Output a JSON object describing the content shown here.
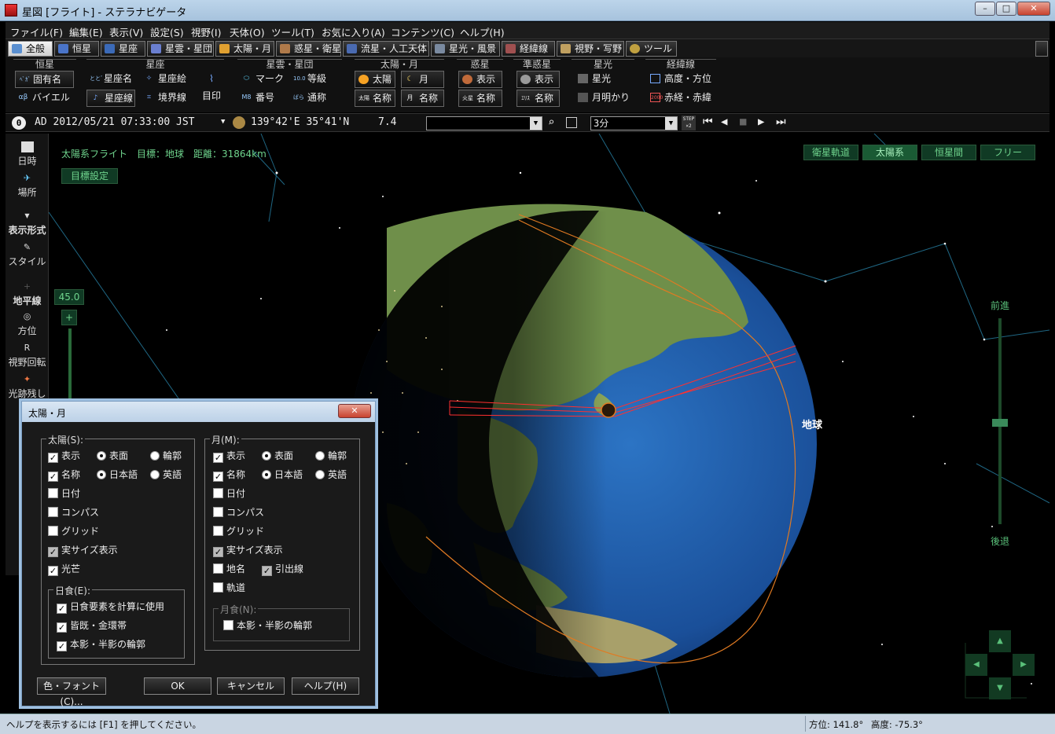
{
  "window": {
    "title": "星図 [フライト] - ステラナビゲータ",
    "min": "–",
    "max": "□",
    "close": "✕"
  },
  "menu": [
    "ファイル(F)",
    "編集(E)",
    "表示(V)",
    "設定(S)",
    "視野(I)",
    "天体(O)",
    "ツール(T)",
    "お気に入り(A)",
    "コンテンツ(C)",
    "ヘルプ(H)"
  ],
  "tabs": [
    "全般",
    "恒星",
    "星座",
    "星雲・星団",
    "太陽・月",
    "惑星・衛星",
    "流星・人工天体",
    "星光・風景",
    "経緯線",
    "視野・写野",
    "ツール"
  ],
  "toolbar": {
    "groups": [
      "恒星",
      "星座",
      "星雲・星団",
      "太陽・月",
      "惑星",
      "準惑星",
      "星光",
      "経緯線"
    ],
    "star_name": "固有名",
    "star_bayer": "バイエル",
    "const_name": "星座名",
    "const_art": "星座絵",
    "const_line": "星座線",
    "const_boundary": "境界線",
    "const_mark": "目印",
    "neb_mark": "マーク",
    "neb_mag": "等級",
    "neb_number": "番号",
    "neb_common": "通称",
    "sun": "太陽",
    "moon": "月",
    "sun_name": "名称",
    "moon_name": "名称",
    "planet_show": "表示",
    "planet_name": "名称",
    "dwarf_show": "表示",
    "dwarf_name": "名称",
    "starlight": "星光",
    "moonlight": "月明かり",
    "altaz": "高度・方位",
    "radec": "赤経・赤緯",
    "icon_labels": {
      "bayer": "αβ",
      "proper": "ﾍﾞｶﾞ",
      "neb_mag": "10.0",
      "neb_num": "M8",
      "neb_common": "ばら",
      "sun_name": "太陽",
      "moon_name": "月",
      "planet_name": "火星",
      "dwarf_name": "ｴﾘｽ",
      "const_name": "ととﾞ",
      "radec": "2000"
    }
  },
  "datebar": {
    "badge": "0",
    "datetime": "AD 2012/05/21 07:33:00 JST",
    "location": "139°42'E 35°41'N",
    "value": "7.4",
    "step": "3分",
    "step_icon": "STEP ×2"
  },
  "sidebar": [
    "日時",
    "場所",
    "表示形式",
    "スタイル",
    "地平線",
    "方位",
    "視野回転",
    "光跡残し"
  ],
  "scene": {
    "info": "太陽系フライト　目標：地球　距離：31864km",
    "target_btn": "目標設定",
    "modes": [
      "衛星軌道",
      "太陽系",
      "恒星間",
      "フリー"
    ],
    "fov": "45.0",
    "plus": "+",
    "forward": "前進",
    "backward": "後退",
    "earth_label": "地球",
    "colors": {
      "accent": "#6fd48d",
      "ocean": "#1f5fae",
      "orbit": "#e07a22",
      "path": "#ff3030"
    }
  },
  "dialog": {
    "title": "太陽・月",
    "close": "✕",
    "sun_group": "太陽(S):",
    "moon_group": "月(M):",
    "show": "表示",
    "surface": "表面",
    "outline": "輪郭",
    "name": "名称",
    "japanese": "日本語",
    "english": "英語",
    "date": "日付",
    "compass": "コンパス",
    "grid": "グリッド",
    "realsize": "実サイズ表示",
    "glare": "光芒",
    "eclipse_group": "日食(E):",
    "eclipse_calc": "日食要素を計算に使用",
    "eclipse_total": "皆既・金環帯",
    "eclipse_shadow": "本影・半影の輪郭",
    "place": "地名",
    "leader": "引出線",
    "orbit": "軌道",
    "lunar_group": "月食(N):",
    "lunar_shadow": "本影・半影の輪郭",
    "btn_font": "色・フォント(C)...",
    "btn_ok": "OK",
    "btn_cancel": "キャンセル",
    "btn_help": "ヘルプ(H)"
  },
  "status": {
    "help": "ヘルプを表示するには [F1] を押してください。",
    "azimuth": "方位: 141.8°",
    "altitude": "高度: -75.3°"
  }
}
